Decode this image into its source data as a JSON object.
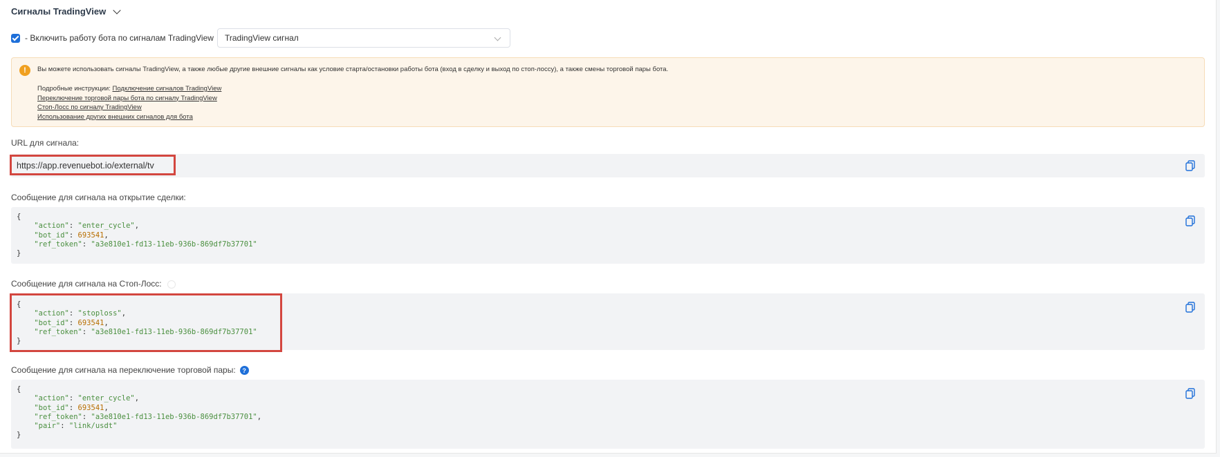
{
  "section": {
    "title": "Сигналы TradingView"
  },
  "enable": {
    "label": "- Включить работу бота по сигналам TradingView",
    "checked": true,
    "select_value": "TradingView сигнал"
  },
  "info": {
    "text": "Вы можете использовать сигналы TradingView, а также любые другие внешние сигналы как условие старта/остановки работы бота (вход в сделку и выход по стоп-лоссу), а также смены торговой пары бота.",
    "instructions_prefix": "Подробные инструкции: ",
    "links": [
      "Подключение сигналов TradingView",
      "Переключение торговой пары бота по сигналу TradingView",
      "Стоп-Лосс по сигналу TradingView",
      "Использование других внешних сигналов для бота"
    ]
  },
  "url": {
    "label": "URL для сигнала:",
    "value": "https://app.revenuebot.io/external/tv"
  },
  "open_signal": {
    "label": "Сообщение для сигнала на открытие сделки:",
    "action": "\"enter_cycle\"",
    "bot_id": "693541",
    "ref_token": "\"a3e810e1-fd13-11eb-936b-869df7b37701\""
  },
  "stoploss_signal": {
    "label": "Сообщение для сигнала на Стоп-Лосс:",
    "action": "\"stoploss\"",
    "bot_id": "693541",
    "ref_token": "\"a3e810e1-fd13-11eb-936b-869df7b37701\""
  },
  "pair_signal": {
    "label": "Сообщение для сигнала на переключение торговой пары:",
    "action": "\"enter_cycle\"",
    "bot_id": "693541",
    "ref_token": "\"a3e810e1-fd13-11eb-936b-869df7b37701\"",
    "pair": "\"link/usdt\""
  },
  "code_keys": {
    "open_brace": "{",
    "close_brace": "}",
    "action": "\"action\"",
    "bot_id": "\"bot_id\"",
    "ref_token": "\"ref_token\"",
    "pair": "\"pair\""
  },
  "icons": {
    "copy": "copy-icon",
    "help": "help-icon",
    "warning": "warning-icon",
    "chevron": "chevron-down-icon"
  },
  "colors": {
    "accent": "#1e6fd9",
    "highlight": "#d3463f",
    "warning": "#f0a020",
    "code_string": "#4a8f3f",
    "code_number": "#b86e00"
  }
}
